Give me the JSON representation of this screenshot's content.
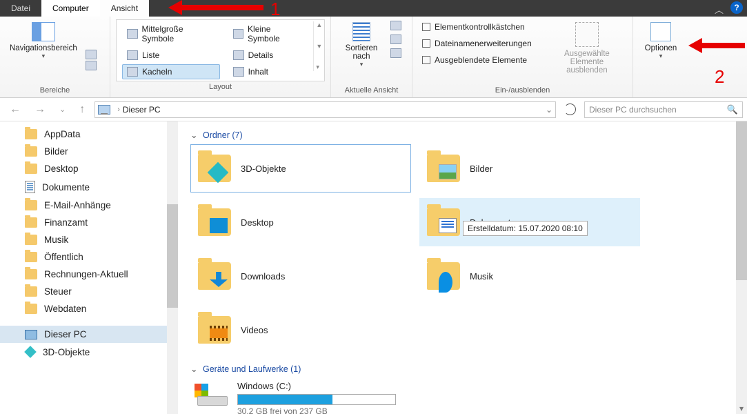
{
  "tabs": {
    "file": "Datei",
    "computer": "Computer",
    "view": "Ansicht"
  },
  "ribbon": {
    "panes": {
      "nav_label": "Navigationsbereich",
      "areas": "Bereiche"
    },
    "layout": {
      "medium": "Mittelgroße Symbole",
      "small": "Kleine Symbole",
      "list": "Liste",
      "details": "Details",
      "tiles": "Kacheln",
      "content": "Inhalt",
      "group": "Layout"
    },
    "sort": {
      "label": "Sortieren nach",
      "group": "Aktuelle Ansicht"
    },
    "show": {
      "chk": "Elementkontrollkästchen",
      "ext": "Dateinamenerweiterungen",
      "hid": "Ausgeblendete Elemente",
      "hide_btn": "Ausgewählte Elemente ausblenden",
      "group": "Ein-/ausblenden"
    },
    "options": "Optionen"
  },
  "address": {
    "root": "Dieser PC"
  },
  "search": {
    "placeholder": "Dieser PC durchsuchen"
  },
  "tree": [
    {
      "label": "AppData",
      "icon": "fold"
    },
    {
      "label": "Bilder",
      "icon": "fold"
    },
    {
      "label": "Desktop",
      "icon": "fold"
    },
    {
      "label": "Dokumente",
      "icon": "doc"
    },
    {
      "label": "E-Mail-Anhänge",
      "icon": "fold"
    },
    {
      "label": "Finanzamt",
      "icon": "fold"
    },
    {
      "label": "Musik",
      "icon": "fold"
    },
    {
      "label": "Öffentlich",
      "icon": "fold"
    },
    {
      "label": "Rechnungen-Aktuell",
      "icon": "fold"
    },
    {
      "label": "Steuer",
      "icon": "fold"
    },
    {
      "label": "Webdaten",
      "icon": "fold"
    },
    {
      "label": "Dieser PC",
      "icon": "pc",
      "sel": true
    },
    {
      "label": "3D-Objekte",
      "icon": "cube"
    }
  ],
  "sections": {
    "folders": {
      "title": "Ordner (7)"
    },
    "drives": {
      "title": "Geräte und Laufwerke (1)"
    }
  },
  "tiles": [
    {
      "label": "3D-Objekte",
      "ov": "ov-cube",
      "outlined": true
    },
    {
      "label": "Bilder",
      "ov": "ov-pic"
    },
    {
      "label": "Desktop",
      "ov": "ov-desk"
    },
    {
      "label": "Dokumente",
      "ov": "ov-doc",
      "hover": true,
      "tooltip": "Erstelldatum: 15.07.2020 08:10"
    },
    {
      "label": "Downloads",
      "ov": "ov-down"
    },
    {
      "label": "Musik",
      "ov": "ov-note"
    },
    {
      "label": "Videos",
      "ov": "ov-film"
    }
  ],
  "drive": {
    "label": "Windows  (C:)",
    "usage_text": "30,2 GB frei von 237 GB"
  },
  "annot": {
    "n1": "1",
    "n2": "2"
  }
}
